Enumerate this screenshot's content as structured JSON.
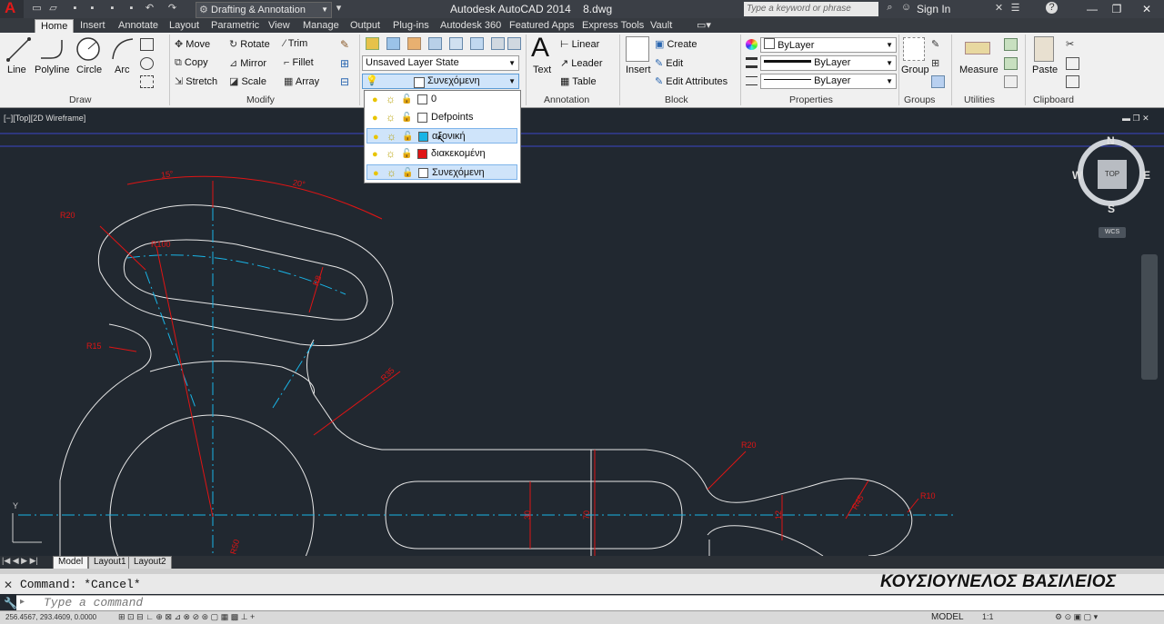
{
  "window": {
    "title": "Autodesk AutoCAD 2014",
    "filename": "8.dwg",
    "workspace": "Drafting & Annotation",
    "search_placeholder": "Type a keyword or phrase",
    "signin": "Sign In"
  },
  "tabs": [
    "Home",
    "Insert",
    "Annotate",
    "Layout",
    "Parametric",
    "View",
    "Manage",
    "Output",
    "Plug-ins",
    "Autodesk 360",
    "Featured Apps",
    "Express Tools",
    "Vault"
  ],
  "ribbon": {
    "draw": {
      "title": "Draw",
      "line": "Line",
      "polyline": "Polyline",
      "circle": "Circle",
      "arc": "Arc"
    },
    "modify": {
      "title": "Modify",
      "move": "Move",
      "rotate": "Rotate",
      "trim": "Trim",
      "copy": "Copy",
      "mirror": "Mirror",
      "fillet": "Fillet",
      "stretch": "Stretch",
      "scale": "Scale",
      "array": "Array"
    },
    "layers": {
      "state": "Unsaved Layer State",
      "current": "Συνεχόμενη"
    },
    "annotation": {
      "title": "Annotation",
      "text": "Text",
      "linear": "Linear",
      "leader": "Leader",
      "table": "Table"
    },
    "block": {
      "title": "Block",
      "insert": "Insert",
      "create": "Create",
      "edit": "Edit",
      "edit_attributes": "Edit Attributes"
    },
    "properties": {
      "title": "Properties",
      "color": "ByLayer",
      "linetype": "ByLayer",
      "lineweight": "ByLayer"
    },
    "groups": {
      "title": "Groups",
      "group": "Group"
    },
    "utilities": {
      "title": "Utilities",
      "measure": "Measure"
    },
    "clipboard": {
      "title": "Clipboard",
      "paste": "Paste"
    }
  },
  "layer_list": [
    {
      "name": "0",
      "color": "#ffffff",
      "selected": false
    },
    {
      "name": "Defpoints",
      "color": "#ffffff",
      "selected": false
    },
    {
      "name": "αξονική",
      "color": "#19b4e6",
      "selected": true
    },
    {
      "name": "διακεκομένη",
      "color": "#e01414",
      "selected": false
    },
    {
      "name": "Συνεχόμενη",
      "color": "#ffffff",
      "selected": true
    }
  ],
  "viewport": {
    "label": "[−][Top][2D Wireframe]"
  },
  "viewcube": {
    "top": "TOP",
    "n": "N",
    "s": "S",
    "e": "E",
    "w": "W",
    "wcs": "WCS"
  },
  "drawing_labels": {
    "angle1": "15°",
    "angle2": "20°",
    "r20a": "R20",
    "r100": "R100",
    "r15": "R15",
    "r35": "R35",
    "r20b": "R20",
    "r10": "R10",
    "d30": "30",
    "d70": "70",
    "d12": "12",
    "r45": "R45",
    "r8": "R8",
    "r50": "R50"
  },
  "layout_tabs": [
    "Model",
    "Layout1",
    "Layout2"
  ],
  "command": {
    "history": "Command: *Cancel*",
    "placeholder": "Type a command"
  },
  "author": "ΚΟΥΣΙΟΥΝΕΛΟΣ ΒΑΣΙΛΕΙΟΣ",
  "status": {
    "coords": "256.4567, 293.4609, 0.0000",
    "model": "MODEL",
    "scale": "1:1"
  },
  "colors": {
    "drawing_bg": "#212830",
    "geometry": "#e6e6e6",
    "dims": "#e01414",
    "centerlines": "#19b4e6"
  }
}
